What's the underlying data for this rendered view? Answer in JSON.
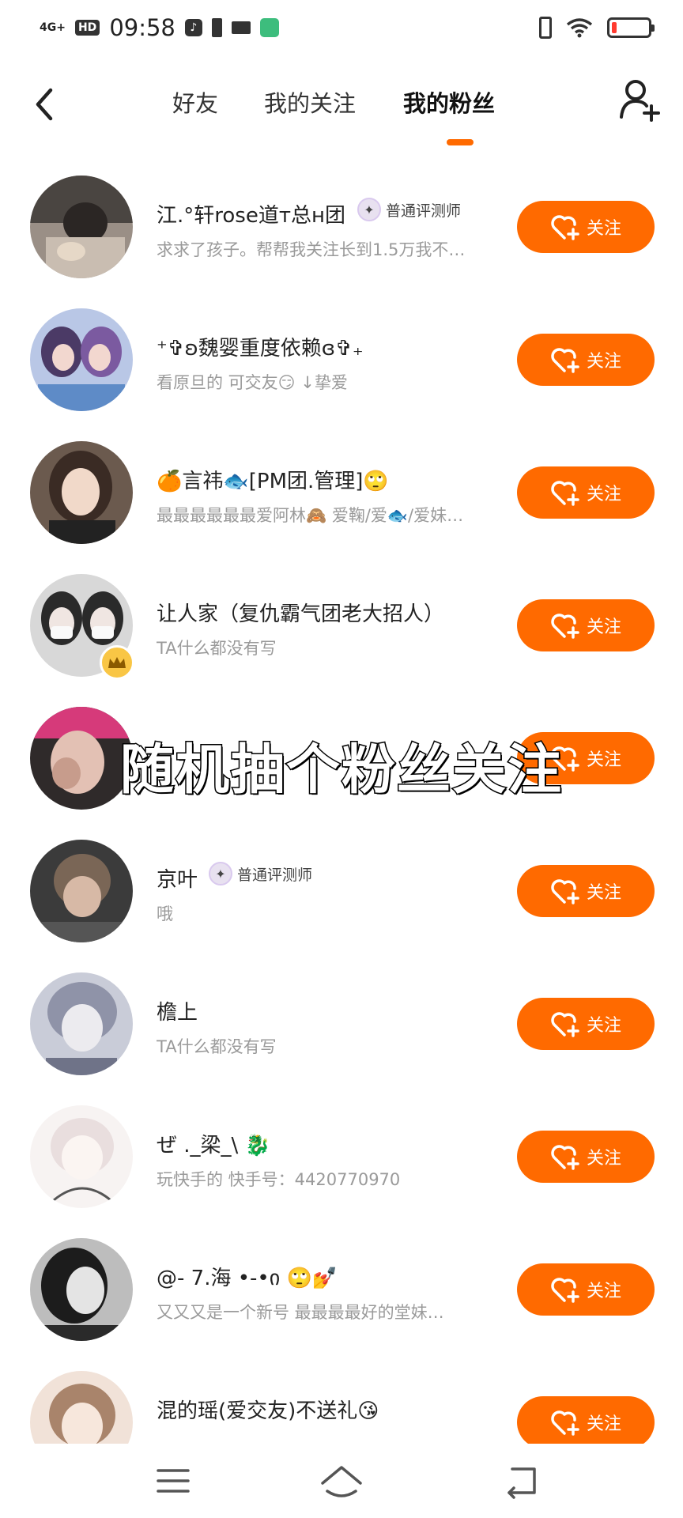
{
  "status_bar": {
    "network": "4G+",
    "hd": "HD",
    "time": "09:58",
    "tiktok_glyph": "♪"
  },
  "tabs": [
    {
      "label": "好友",
      "active": false
    },
    {
      "label": "我的关注",
      "active": false
    },
    {
      "label": "我的粉丝",
      "active": true
    }
  ],
  "colors": {
    "accent": "#ff6a00",
    "muted_text": "#9a9a9a"
  },
  "fans": [
    {
      "name": "江.°轩rose道ᴛ总ʜ团",
      "badge": "普通评测师",
      "desc": "求求了孩子。帮帮我关注长到1.5万我不…",
      "follow_label": "关注"
    },
    {
      "name": "⁺✞ʚ魏婴重度依赖ɞ✞₊",
      "badge": "",
      "desc": "看原旦的  可交友😏  ↓挚爱",
      "follow_label": "关注"
    },
    {
      "name": "🍊言祎🐟[PM团.管理]🙄",
      "badge": "",
      "desc": "最最最最最最爱阿林🙈  爱鞠/爱🐟/爱妹…",
      "follow_label": "关注"
    },
    {
      "name": "让人家（复仇霸气团老大招人）",
      "badge": "",
      "desc": "TA什么都没有写",
      "follow_label": "关注"
    },
    {
      "name": "",
      "badge": "",
      "desc": "",
      "follow_label": "关注"
    },
    {
      "name": "京叶",
      "badge": "普通评测师",
      "desc": "哦",
      "follow_label": "关注"
    },
    {
      "name": "檐上",
      "badge": "",
      "desc": "TA什么都没有写",
      "follow_label": "关注"
    },
    {
      "name": "ぜ ._梁_\\ 🐉",
      "badge": "",
      "desc": "玩快手的  快手号：4420770970",
      "follow_label": "关注"
    },
    {
      "name": "@-  7.海  •-•ი  🙄💅",
      "badge": "",
      "desc": "又又又是一个新号  最最最最好的堂妹…",
      "follow_label": "关注"
    },
    {
      "name": "混的瑶(爱交友)不送礼😘",
      "badge": "",
      "desc": "",
      "follow_label": "关注"
    }
  ],
  "overlay_caption": "随机抽个粉丝关注"
}
